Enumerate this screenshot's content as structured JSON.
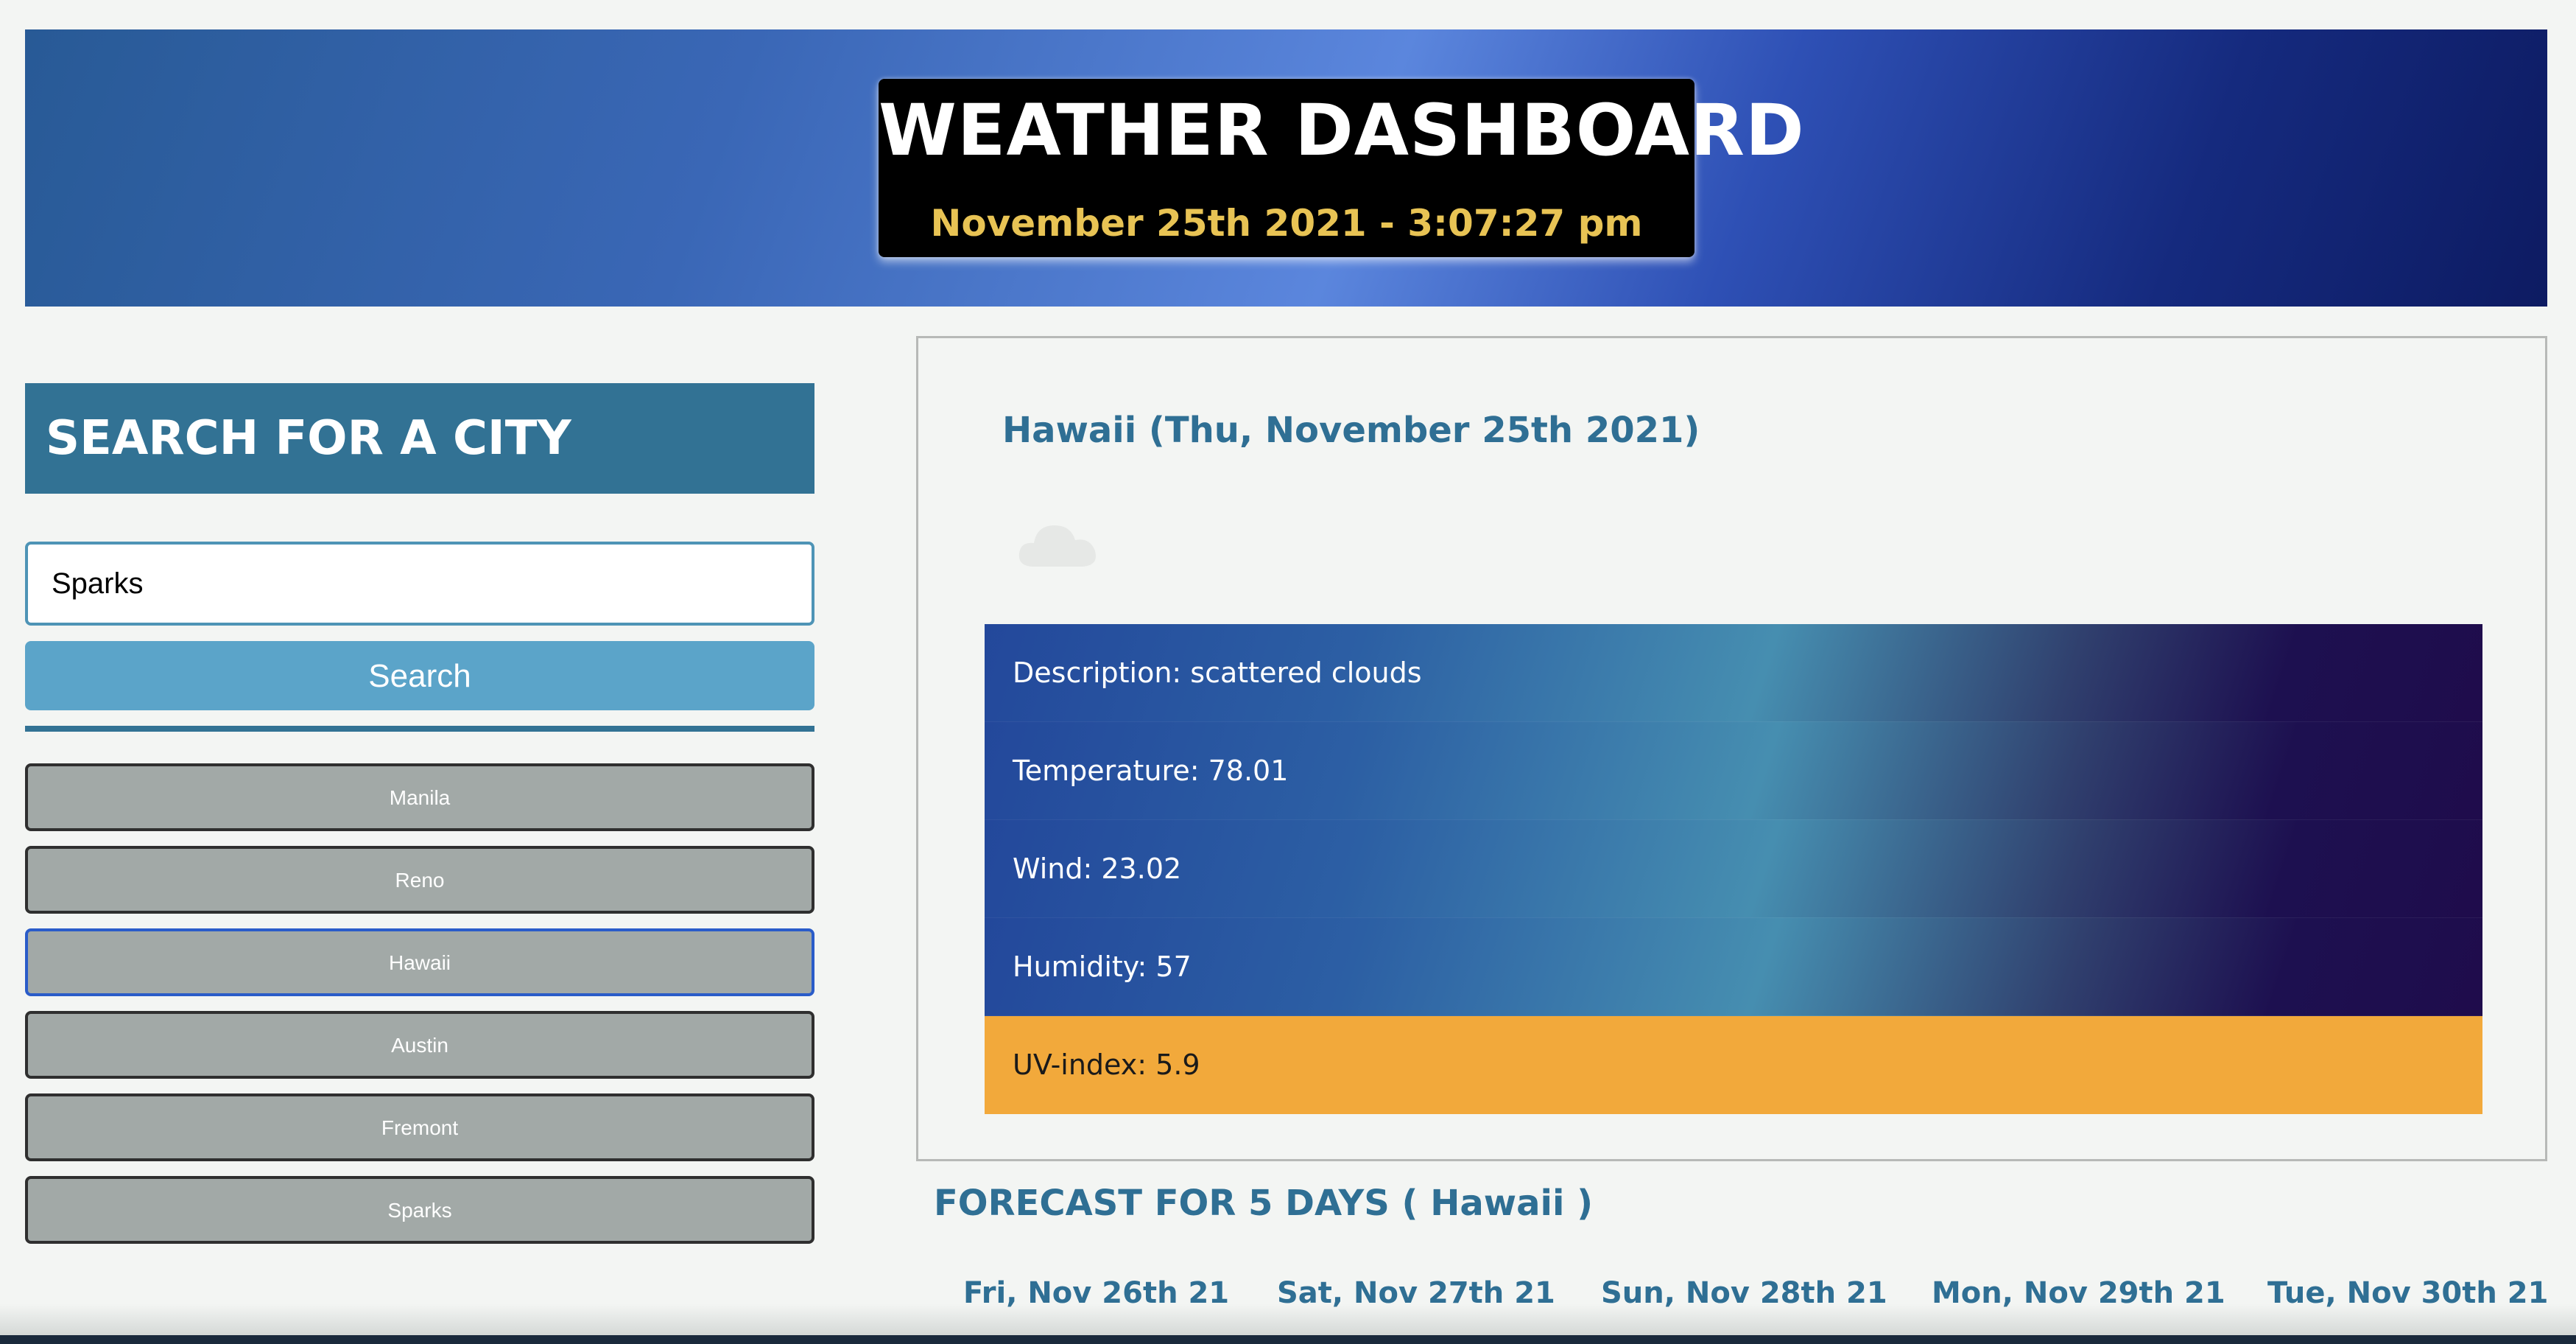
{
  "header": {
    "title": "WEATHER DASHBOARD",
    "datetime": "November 25th 2021 - 3:07:27 pm"
  },
  "search": {
    "heading": "SEARCH FOR A CITY",
    "input_value": "Sparks",
    "button_label": "Search"
  },
  "history": {
    "cities": [
      "Manila",
      "Reno",
      "Hawaii",
      "Austin",
      "Fremont",
      "Sparks"
    ],
    "active": "Hawaii"
  },
  "current": {
    "heading": "Hawaii (Thu, November 25th 2021)",
    "icon": "cloud-icon",
    "description": "Description: scattered clouds",
    "temperature": "Temperature: 78.01",
    "wind": "Wind: 23.02",
    "humidity": "Humidity: 57",
    "uv_index": "UV-index: 5.9",
    "uv_color": "#f2a93b"
  },
  "forecast": {
    "title": "FORECAST FOR 5 DAYS ( Hawaii )",
    "days": [
      "Fri, Nov 26th 21",
      "Sat, Nov 27th 21",
      "Sun, Nov 28th 21",
      "Mon, Nov 29th 21",
      "Tue, Nov 30th 21"
    ]
  },
  "colors": {
    "accent": "#327294",
    "button": "#5ba4c9",
    "heading_text": "#2f6f94",
    "date_gold": "#e8c354"
  }
}
